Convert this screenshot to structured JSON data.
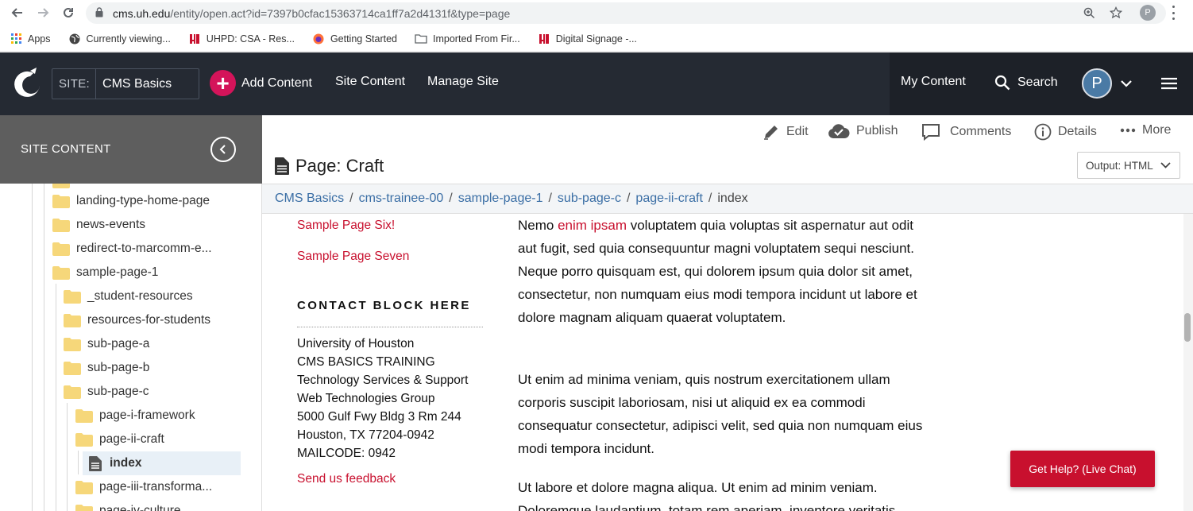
{
  "browser": {
    "url_host": "cms.uh.edu",
    "url_path": "/entity/open.act?id=7397b0cfac15363714ca1ff7a2d4131f&type=page",
    "profile_initial": "P",
    "bookmarks": [
      {
        "label": "Apps",
        "icon": "apps-grid-icon"
      },
      {
        "label": "Currently viewing...",
        "icon": "globe-icon"
      },
      {
        "label": "UHPD: CSA - Res...",
        "icon": "uh-logo-icon"
      },
      {
        "label": "Getting Started",
        "icon": "firefox-icon"
      },
      {
        "label": "Imported From Fir...",
        "icon": "folder-icon"
      },
      {
        "label": "Digital Signage -...",
        "icon": "uh-logo-icon"
      }
    ]
  },
  "header": {
    "site_label": "SITE:",
    "site_name": "CMS Basics",
    "add_content": "Add Content",
    "site_content": "Site Content",
    "manage_site": "Manage Site",
    "my_content": "My Content",
    "search": "Search",
    "user_initial": "P"
  },
  "sidebar": {
    "title": "SITE CONTENT",
    "items": [
      {
        "label": "landing-type-home-page"
      },
      {
        "label": "news-events"
      },
      {
        "label": "redirect-to-marcomm-e..."
      },
      {
        "label": "sample-page-1"
      },
      {
        "label": "_student-resources"
      },
      {
        "label": "resources-for-students"
      },
      {
        "label": "sub-page-a"
      },
      {
        "label": "sub-page-b"
      },
      {
        "label": "sub-page-c"
      },
      {
        "label": "page-i-framework"
      },
      {
        "label": "page-ii-craft"
      },
      {
        "label": "index"
      },
      {
        "label": "page-iii-transforma..."
      },
      {
        "label": "page-iv-culture"
      }
    ]
  },
  "toolbar": {
    "edit": "Edit",
    "publish": "Publish",
    "comments": "Comments",
    "details": "Details",
    "more": "More",
    "page_title": "Page: Craft",
    "output": "Output: HTML"
  },
  "breadcrumb": {
    "items": [
      "CMS Basics",
      "cms-trainee-00",
      "sample-page-1",
      "sub-page-c",
      "page-ii-craft"
    ],
    "current": "index"
  },
  "preview": {
    "link_six": "Sample Page Six!",
    "link_seven": "Sample Page Seven",
    "contact_heading": "CONTACT BLOCK HERE",
    "contact_lines": [
      "University of Houston",
      "CMS BASICS TRAINING",
      "Technology Services & Support",
      "Web Technologies Group",
      "5000 Gulf Fwy Bldg 3 Rm 244",
      "Houston, TX 77204-0942",
      "MAILCODE: 0942"
    ],
    "feedback": "Send us feedback",
    "para1_pre": "Nemo ",
    "para1_link": "enim ipsam",
    "para1_post": " voluptatem quia voluptas sit aspernatur aut odit aut fugit, sed quia consequuntur magni voluptatem sequi nesciunt. Neque porro quisquam est, qui dolorem ipsum quia dolor sit amet, consectetur, non numquam eius modi tempora incidunt ut labore et dolore magnam aliquam quaerat voluptatem.",
    "para2": "Ut enim ad minima veniam, quis nostrum exercitationem ullam corporis suscipit laboriosam, nisi ut aliquid ex ea commodi consequatur consectetur, adipisci velit, sed quia non numquam eius modi tempora incidunt.",
    "para3": "Ut labore et dolore magna aliqua. Ut enim ad minim veniam. Doloremque laudantium, totam rem aperiam, inventore veritatis"
  },
  "help_button": "Get Help? (Live Chat)",
  "colors": {
    "header_bg": "#252a33",
    "accent_pink": "#d4145a",
    "link_red": "#c8102e",
    "crumb_blue": "#3a6ea5",
    "sidebar_head": "#5e5e5e"
  }
}
